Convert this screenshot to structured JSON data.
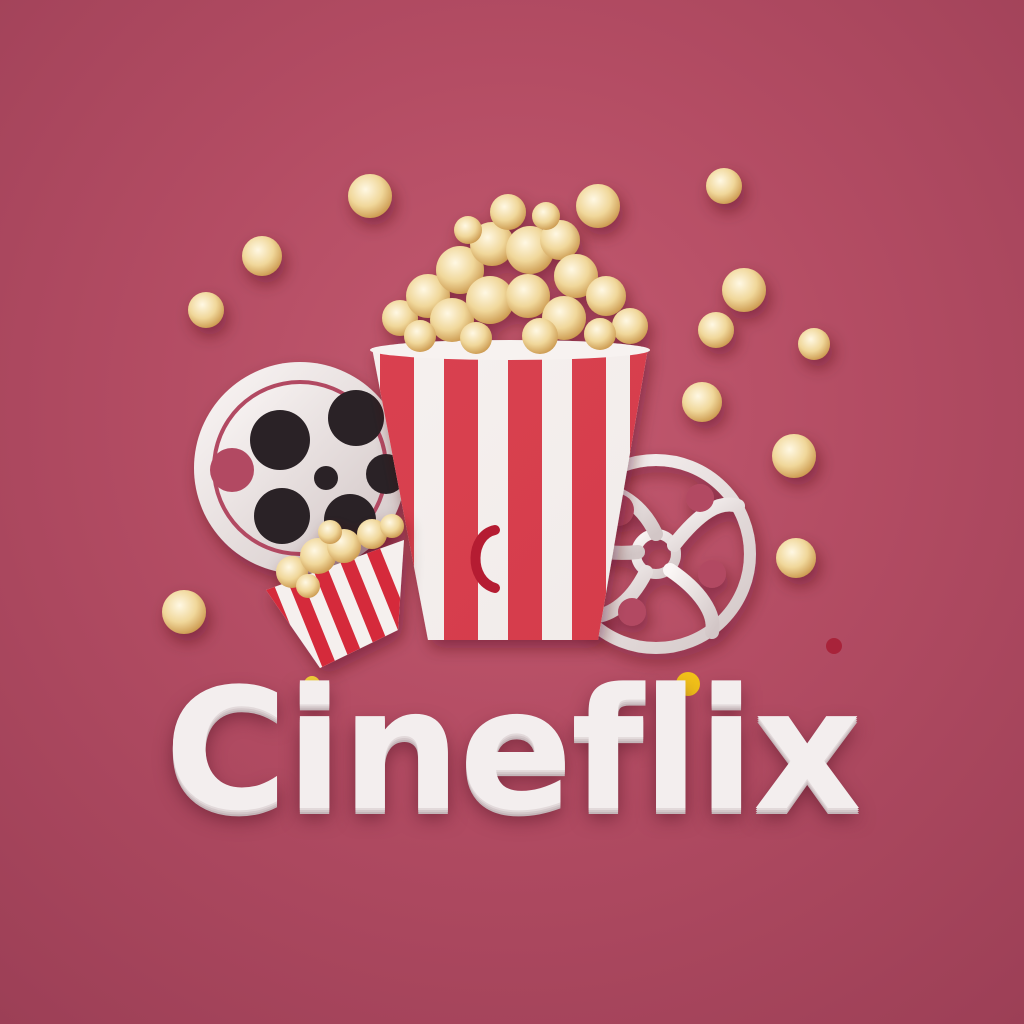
{
  "brand": {
    "name": "Cineflix"
  },
  "colors": {
    "background": "#b94f66",
    "stripe_red": "#d5293a",
    "stripe_white": "#f5f0ee",
    "reel": "#ece4e3",
    "popcorn": "#f0d79a",
    "wordmark": "#f3eeee"
  },
  "icons": [
    "popcorn-bucket-icon",
    "film-reel-icon",
    "popcorn-kernel-icon"
  ]
}
